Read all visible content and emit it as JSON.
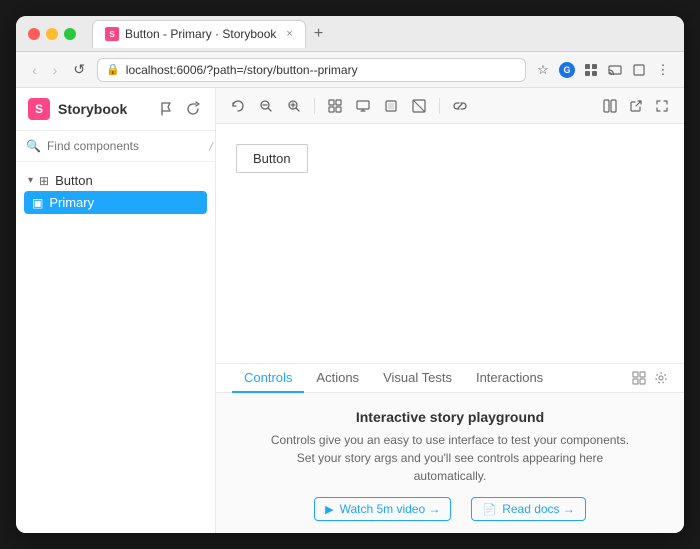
{
  "browser": {
    "tab_title": "Button - Primary · Storybook",
    "tab_close": "×",
    "tab_new": "+",
    "url": "localhost:6006/?path=/story/button--primary",
    "nav_back": "‹",
    "nav_forward": "›",
    "nav_refresh": "↺",
    "bookmark_icon": "☆",
    "extensions": [
      "👤"
    ],
    "menu_icon": "⋮",
    "window_icon": "⊡",
    "share_icon": "⬆",
    "cast_icon": "⊟"
  },
  "storybook": {
    "logo_letter": "S",
    "title": "Storybook",
    "header_icons": [
      "🚩",
      "🔄"
    ],
    "search_placeholder": "Find components",
    "search_shortcut": "/",
    "tree": {
      "button_group": "Button",
      "button_item": "Primary"
    }
  },
  "canvas": {
    "toolbar_icons": [
      "↺",
      "🔍−",
      "🔍+",
      "⊞",
      "⊟",
      "⊠",
      "⊡",
      "📋"
    ],
    "right_icons": [
      "⊞",
      "⛶"
    ],
    "preview_button_label": "Button"
  },
  "panel": {
    "tabs": [
      "Controls",
      "Actions",
      "Visual Tests",
      "Interactions"
    ],
    "active_tab": "Controls",
    "tab_icons": [
      "⊞",
      "⊙"
    ],
    "title": "Interactive story playground",
    "description": "Controls give you an easy to use interface to test your components. Set your story args and you'll see controls appearing here automatically.",
    "links": [
      {
        "icon": "▶",
        "label": "Watch 5m video →"
      },
      {
        "icon": "📄",
        "label": "Read docs →"
      }
    ]
  }
}
